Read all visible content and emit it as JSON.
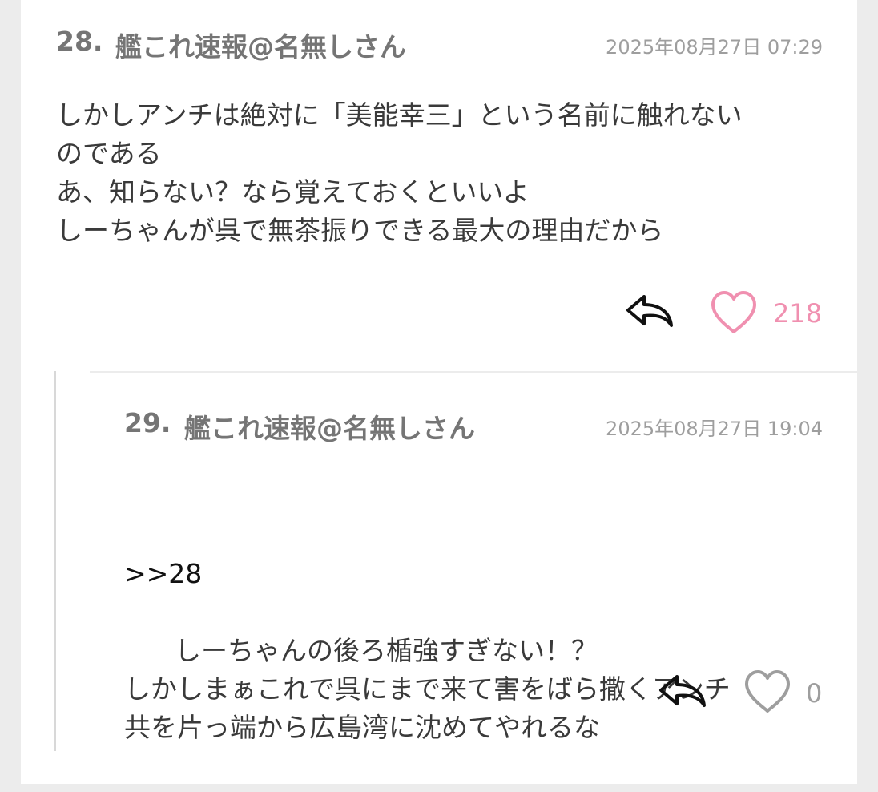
{
  "comments": [
    {
      "number": "28.",
      "author": "艦これ速報@名無しさん",
      "date": "2025年08月27日 07:29",
      "anchor": "",
      "body": "しかしアンチは絶対に「美能幸三」という名前に触れない\nのである\nあ、知らない？なら覚えておくといいよ\nしーちゃんが呉で無茶振りできる最大の理由だから",
      "likes": "218",
      "liked": true
    },
    {
      "number": "29.",
      "author": "艦これ速報@名無しさん",
      "date": "2025年08月27日 19:04",
      "anchor": ">>28",
      "body": "しーちゃんの後ろ楯強すぎない！？\nしかしまぁこれで呉にまで来て害をばら撒くアンチ\n共を片っ端から広島湾に沈めてやれるな",
      "likes": "0",
      "liked": false
    }
  ],
  "icons": {
    "reply": "reply-arrow-icon",
    "like": "heart-icon"
  },
  "colors": {
    "liked_accent": "#f090b0",
    "unliked": "#9e9e9e",
    "meta_text": "#757575",
    "body_text": "#3a3a3a"
  }
}
